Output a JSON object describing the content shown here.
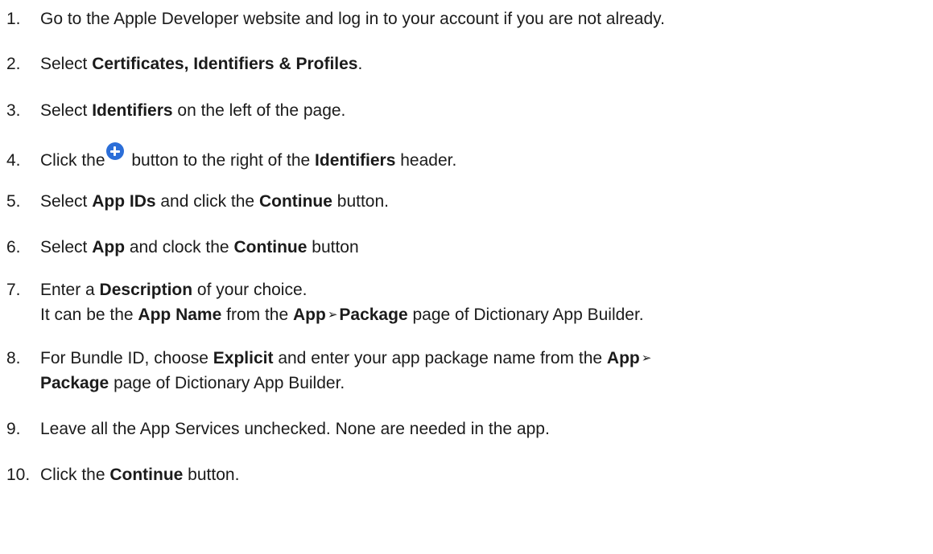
{
  "steps": [
    {
      "number": "1.",
      "parts": [
        {
          "text": "Go to the Apple Developer website and log in to your account if you are not already."
        }
      ]
    },
    {
      "number": "2.",
      "parts": [
        {
          "text": "Select "
        },
        {
          "text": "Certificates, Identifiers & Profiles",
          "bold": true
        },
        {
          "text": "."
        }
      ]
    },
    {
      "number": "3.",
      "parts": [
        {
          "text": "Select "
        },
        {
          "text": "Identifiers",
          "bold": true
        },
        {
          "text": " on the left of the page."
        }
      ]
    },
    {
      "number": "4.",
      "parts": [
        {
          "text": "Click the"
        },
        {
          "icon": "plus-circle-icon"
        },
        {
          "text": " button to the right of the "
        },
        {
          "text": "Identifiers",
          "bold": true
        },
        {
          "text": " header."
        }
      ]
    },
    {
      "number": "5.",
      "parts": [
        {
          "text": "Select "
        },
        {
          "text": "App IDs",
          "bold": true
        },
        {
          "text": " and click the "
        },
        {
          "text": "Continue",
          "bold": true
        },
        {
          "text": " button."
        }
      ]
    },
    {
      "number": "6.",
      "parts": [
        {
          "text": "Select "
        },
        {
          "text": "App",
          "bold": true
        },
        {
          "text": " and clock the "
        },
        {
          "text": "Continue",
          "bold": true
        },
        {
          "text": " button"
        }
      ]
    },
    {
      "number": "7.",
      "parts": [
        {
          "text": "Enter a "
        },
        {
          "text": "Description",
          "bold": true
        },
        {
          "text": " of your choice."
        },
        {
          "break": true
        },
        {
          "text": "It can be the "
        },
        {
          "text": "App Name",
          "bold": true
        },
        {
          "text": " from the "
        },
        {
          "text": "App",
          "bold": true
        },
        {
          "arrow": "➢"
        },
        {
          "text": "Package",
          "bold": true
        },
        {
          "text": " page of Dictionary App Builder."
        }
      ]
    },
    {
      "number": "8.",
      "parts": [
        {
          "text": "For Bundle ID, choose "
        },
        {
          "text": "Explicit",
          "bold": true
        },
        {
          "text": " and enter your app package name from the "
        },
        {
          "text": "App",
          "bold": true
        },
        {
          "arrow": "➢"
        },
        {
          "break": true
        },
        {
          "text": "Package",
          "bold": true
        },
        {
          "text": " page of Dictionary App Builder."
        }
      ]
    },
    {
      "number": "9.",
      "parts": [
        {
          "text": "Leave all the App Services unchecked. None are needed in the app."
        }
      ]
    },
    {
      "number": "10.",
      "parts": [
        {
          "text": "Click the "
        },
        {
          "text": "Continue",
          "bold": true
        },
        {
          "text": " button."
        }
      ]
    }
  ],
  "colors": {
    "text": "#1b1b1b",
    "icon_blue": "#2b6ed8",
    "background": "#ffffff"
  }
}
